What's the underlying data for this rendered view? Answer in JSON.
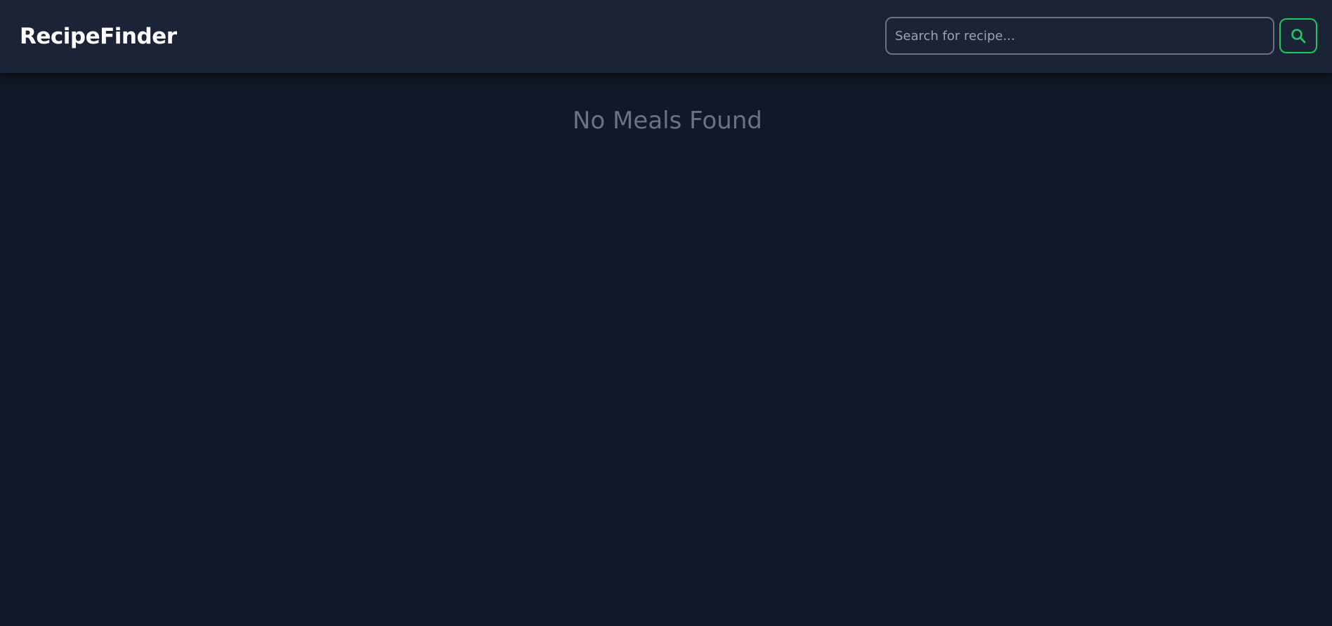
{
  "app": {
    "title": "RecipeFinder"
  },
  "search": {
    "placeholder": "Search for recipe...",
    "value": "",
    "button_icon": "search-icon"
  },
  "results": {
    "empty_message": "No Meals Found"
  },
  "colors": {
    "background": "#111827",
    "navbar": "#1b2436",
    "accent": "#22c55e",
    "muted_text": "#6b7280"
  }
}
